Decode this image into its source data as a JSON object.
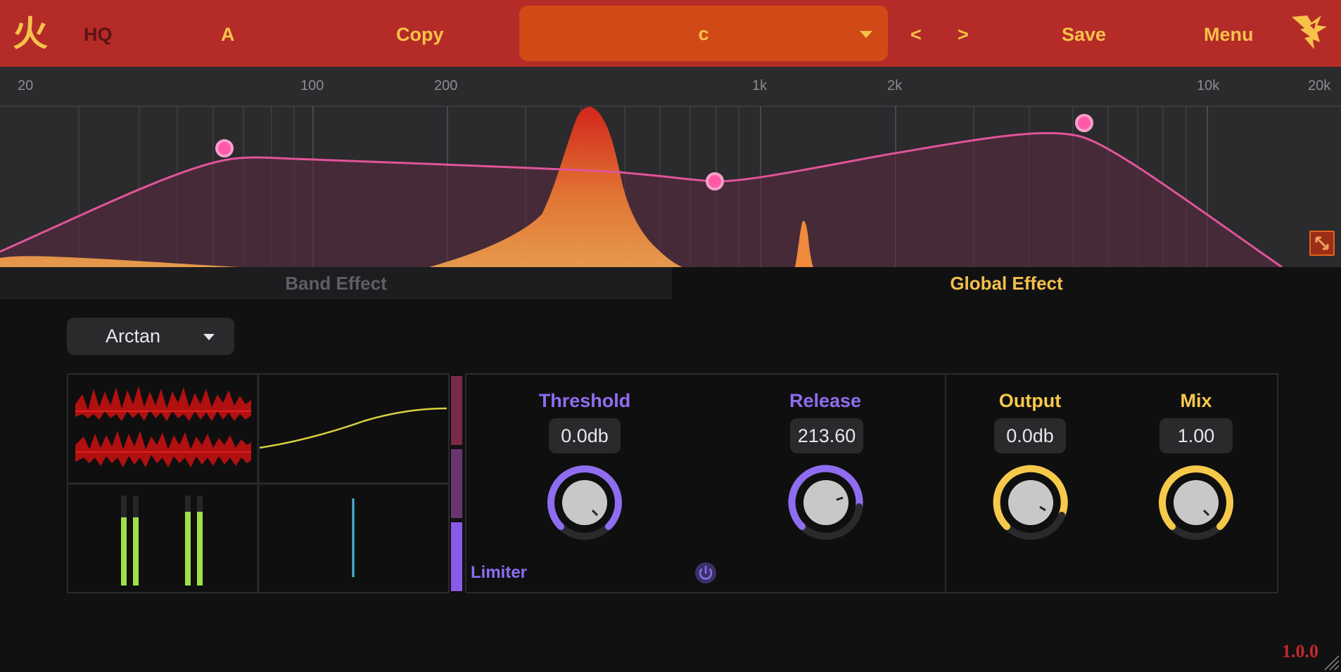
{
  "header": {
    "hq_label": "HQ",
    "ab_label": "A",
    "copy_label": "Copy",
    "preset_name": "c",
    "prev_label": "<",
    "next_label": ">",
    "save_label": "Save",
    "menu_label": "Menu",
    "logo_glyph": "火"
  },
  "eq": {
    "freq_labels": [
      "20",
      "100",
      "200",
      "1k",
      "2k",
      "10k",
      "20k"
    ]
  },
  "tabs": {
    "band": "Band Effect",
    "global": "Global Effect"
  },
  "effect": {
    "type": "Arctan"
  },
  "limiter": {
    "label": "Limiter",
    "threshold_label": "Threshold",
    "threshold_value": "0.0db",
    "release_label": "Release",
    "release_value": "213.60"
  },
  "output": {
    "output_label": "Output",
    "output_value": "0.0db",
    "mix_label": "Mix",
    "mix_value": "1.00"
  },
  "version": "1.0.0",
  "colors": {
    "header_bg": "#b42b28",
    "accent_yellow": "#f7c24a",
    "purple": "#8f6df0",
    "eq_curve": "#e0549a",
    "meter_green": "#9fe04a"
  }
}
